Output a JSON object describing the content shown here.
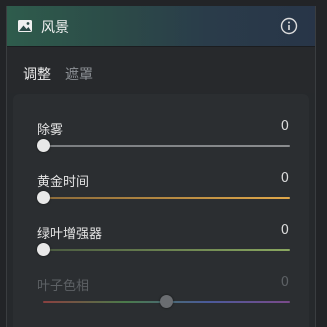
{
  "header": {
    "title": "风景",
    "icon": "landscape-image-icon",
    "info_icon": "info-icon"
  },
  "tabs": [
    {
      "label": "调整",
      "active": true
    },
    {
      "label": "遮罩",
      "active": false
    }
  ],
  "sliders": [
    {
      "label": "除雾",
      "value": "0",
      "level": 0,
      "colors": [
        "#7a7d80",
        "#8a8c8f"
      ],
      "disabled": false
    },
    {
      "label": "黄金时间",
      "value": "0",
      "level": 0,
      "colors": [
        "#8a6a3a",
        "#e0a84a"
      ],
      "disabled": false
    },
    {
      "label": "绿叶增强器",
      "value": "0",
      "level": 0,
      "colors": [
        "#4a5a40",
        "#8aa860"
      ],
      "disabled": false
    },
    {
      "label": "叶子色相",
      "value": "0",
      "level": 0.5,
      "colors": [
        "#8a4040",
        "#4a7a4a",
        "#4a5a9a",
        "#7a4a8a"
      ],
      "disabled": true
    }
  ]
}
